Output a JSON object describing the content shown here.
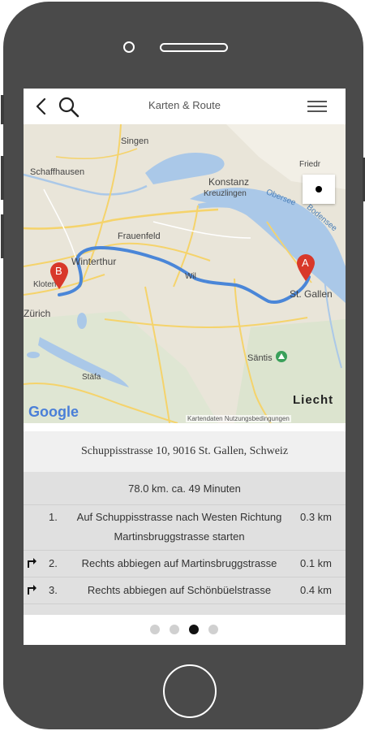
{
  "app": {
    "title": "Karten & Route"
  },
  "map": {
    "labels": {
      "singen": "Singen",
      "schaffhausen": "Schaffhausen",
      "konstanz": "Konstanz",
      "kreuzlingen": "Kreuzlingen",
      "frauenfeld": "Frauenfeld",
      "winterthur": "Winterthur",
      "wil": "Wil",
      "st_gallen": "St. Gallen",
      "zurich": "Zürich",
      "kloten": "Kloten",
      "stafa": "Stäfa",
      "santis": "Säntis",
      "liecht": "Liecht",
      "obersee": "Obersee",
      "bodensee": "Bodensee",
      "friedr": "Friedr"
    },
    "markers": {
      "start": "A",
      "end": "B"
    },
    "logo": "Google",
    "footer": "Kartendaten   Nutzungsbedingungen",
    "route_color": "#4a86d8",
    "marker_color": "#d8382a"
  },
  "address": "Schuppisstrasse 10, 9016 St. Gallen, Schweiz",
  "route": {
    "summary": "78.0 km. ca. 49 Minuten",
    "steps": [
      {
        "num": "1.",
        "instruction": "Auf Schuppisstrasse nach Westen Richtung Martinsbruggstrasse starten",
        "distance": "0.3 km",
        "icon": "none"
      },
      {
        "num": "2.",
        "instruction": "Rechts abbiegen auf Martinsbruggstrasse",
        "distance": "0.1 km",
        "icon": "turn-right-icon"
      },
      {
        "num": "3.",
        "instruction": "Rechts abbiegen auf Schönbüelstrasse",
        "distance": "0.4 km",
        "icon": "turn-right-icon"
      }
    ]
  },
  "pager": {
    "count": 4,
    "active_index": 2
  }
}
